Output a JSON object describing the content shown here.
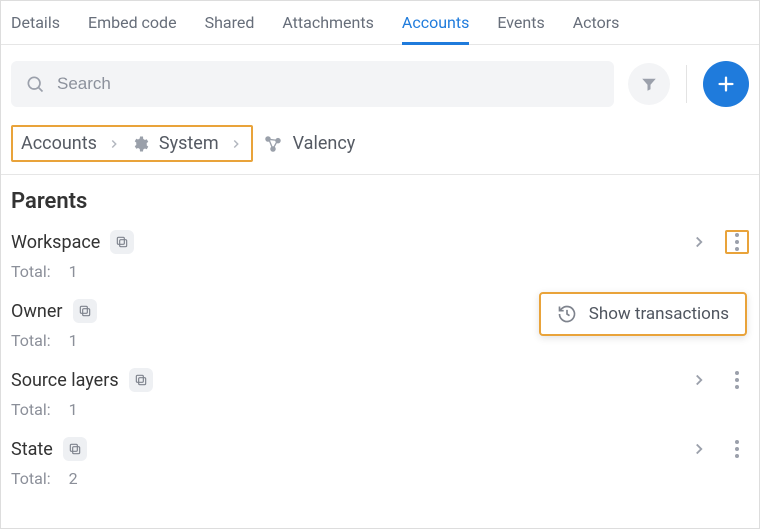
{
  "tabs": {
    "details": "Details",
    "embed": "Embed code",
    "shared": "Shared",
    "attachments": "Attachments",
    "accounts": "Accounts",
    "events": "Events",
    "actors": "Actors"
  },
  "search": {
    "placeholder": "Search"
  },
  "breadcrumb": {
    "accounts": "Accounts",
    "system": "System",
    "valency": "Valency"
  },
  "section_title": "Parents",
  "total_label": "Total:",
  "groups": {
    "workspace": {
      "name": "Workspace",
      "total": "1"
    },
    "owner": {
      "name": "Owner",
      "total": "1"
    },
    "source_layers": {
      "name": "Source layers",
      "total": "1"
    },
    "state": {
      "name": "State",
      "total": "2"
    }
  },
  "popover": {
    "show_transactions": "Show transactions"
  }
}
